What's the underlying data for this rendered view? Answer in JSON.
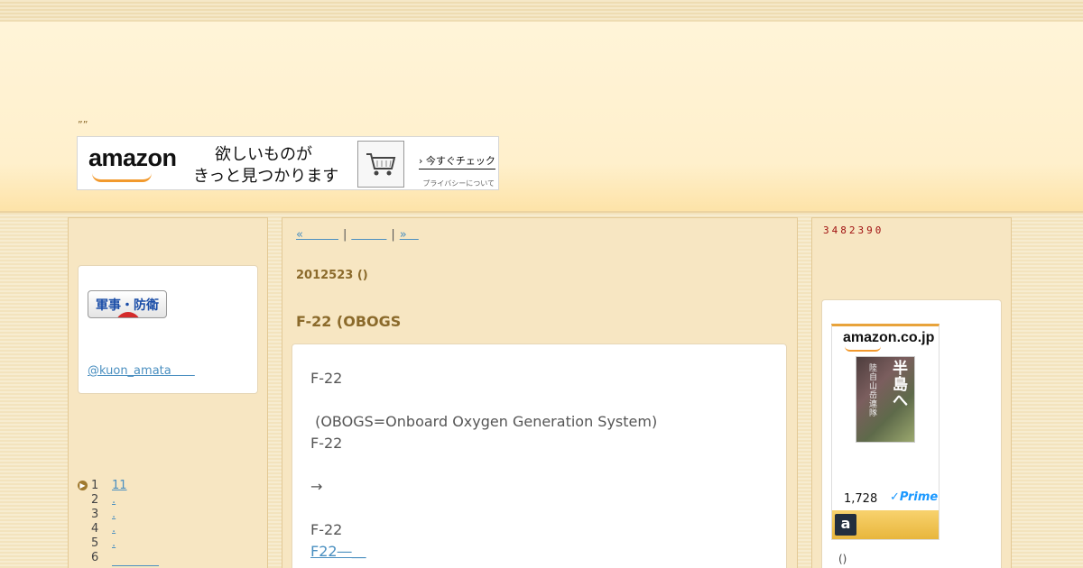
{
  "header": {
    "description": "””",
    "banner": {
      "logo": "amazon",
      "tagline_line1": "欲しいものが",
      "tagline_line2": "きっと見つかります",
      "check_label": "今すぐチェック",
      "privacy": "プライバシーについて"
    }
  },
  "left": {
    "badge_label": "軍事・防衛",
    "twitter_link": "@kuon_amata＿＿",
    "ranking": [
      {
        "rank": "1",
        "label": "11"
      },
      {
        "rank": "2",
        "label": "."
      },
      {
        "rank": "3",
        "label": "."
      },
      {
        "rank": "4",
        "label": "."
      },
      {
        "rank": "5",
        "label": "."
      },
      {
        "rank": "6",
        "label": "＿＿＿＿"
      }
    ]
  },
  "center": {
    "pager": {
      "prev": "«＿＿＿",
      "home": "＿＿＿",
      "next": "»＿",
      "separator": "|"
    },
    "post_date": "2012523 ()",
    "post_title": "F-22 (OBOGS",
    "body_lines": [
      "F-22",
      "",
      " (OBOGS=Onboard Oxygen Generation System)",
      "F-22",
      "",
      "→",
      "",
      "F-22"
    ],
    "body_link": "F22―＿"
  },
  "right": {
    "counter": "3482390",
    "ad": {
      "logo": "amazon.co.jp",
      "book_title": "半島へ",
      "book_subtitle": "陸自山岳連隊",
      "price": "1,728",
      "prime": "✓Prime",
      "a_label": "a"
    },
    "ad_note": "()"
  }
}
